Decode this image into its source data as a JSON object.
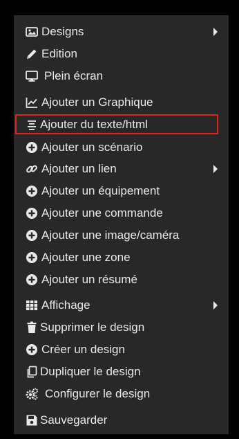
{
  "menu": {
    "items": [
      {
        "label": "Designs",
        "icon": "image-icon",
        "submenu": true
      },
      {
        "label": "Edition",
        "icon": "pencil-icon",
        "submenu": false
      },
      {
        "label": "Plein écran",
        "icon": "monitor-icon",
        "submenu": false
      },
      {
        "label": "Ajouter un Graphique",
        "icon": "line-chart-icon",
        "submenu": false
      },
      {
        "label": "Ajouter du texte/html",
        "icon": "text-align-icon",
        "submenu": false,
        "highlighted": true
      },
      {
        "label": "Ajouter un scénario",
        "icon": "plus-circle-icon",
        "submenu": false
      },
      {
        "label": "Ajouter un lien",
        "icon": "link-icon",
        "submenu": true
      },
      {
        "label": "Ajouter un équipement",
        "icon": "plus-circle-icon",
        "submenu": false
      },
      {
        "label": "Ajouter une commande",
        "icon": "plus-circle-icon",
        "submenu": false
      },
      {
        "label": "Ajouter une image/caméra",
        "icon": "plus-circle-icon",
        "submenu": false
      },
      {
        "label": "Ajouter une zone",
        "icon": "plus-circle-icon",
        "submenu": false
      },
      {
        "label": "Ajouter un résumé",
        "icon": "plus-circle-icon",
        "submenu": false
      },
      {
        "label": "Affichage",
        "icon": "grid-icon",
        "submenu": true
      },
      {
        "label": "Supprimer le design",
        "icon": "trash-icon",
        "submenu": false
      },
      {
        "label": "Créer un design",
        "icon": "plus-circle-icon",
        "submenu": false
      },
      {
        "label": "Dupliquer le design",
        "icon": "copy-icon",
        "submenu": false
      },
      {
        "label": "Configurer le design",
        "icon": "gears-icon",
        "submenu": false
      },
      {
        "label": "Sauvegarder",
        "icon": "save-icon",
        "submenu": false
      }
    ]
  },
  "colors": {
    "background": "#000000",
    "menu": "#282828",
    "text": "#e9e9e9",
    "highlight": "#e2231a"
  }
}
